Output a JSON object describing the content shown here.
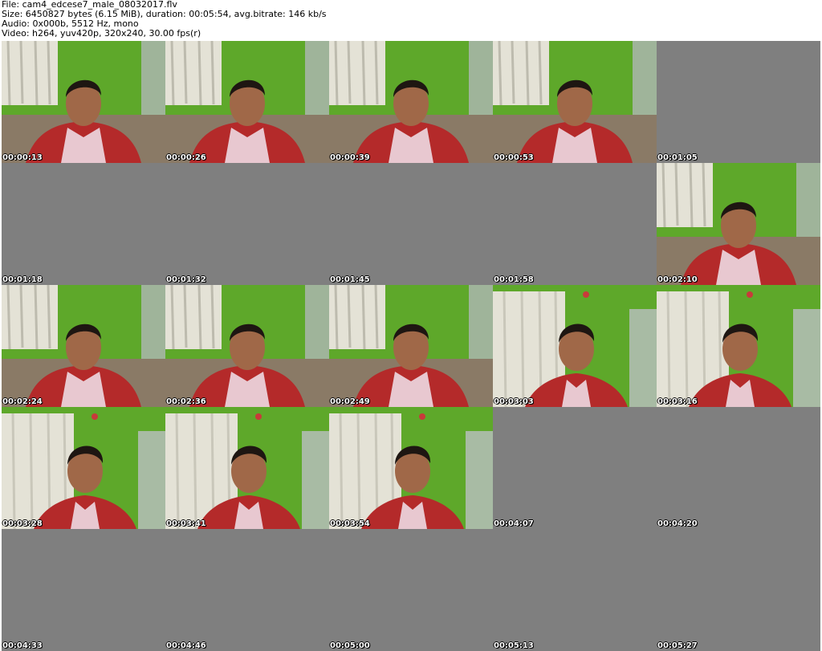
{
  "header": {
    "file_line": "File: cam4_edcese7_male_08032017.flv",
    "size_line": "Size: 6450827 bytes (6.15 MiB), duration: 00:05:54, avg.bitrate: 146 kb/s",
    "audio_line": "Audio: 0x000b, 5512 Hz, mono",
    "video_line": "Video: h264, yuv420p, 320x240, 30.00 fps(r)"
  },
  "colors": {
    "empty_frame": "#7f7f7f",
    "wall_green": "#5ea82a",
    "curtain": "#e4e2d6",
    "shirt": "#e8c8d0",
    "jacket": "#b42a2a",
    "skin": "#a06848",
    "hair": "#1e1612"
  },
  "thumbnails": [
    {
      "time": "00:00:13",
      "frame": "a"
    },
    {
      "time": "00:00:26",
      "frame": "a"
    },
    {
      "time": "00:00:39",
      "frame": "a"
    },
    {
      "time": "00:00:53",
      "frame": "a"
    },
    {
      "time": "00:01:05",
      "frame": "empty"
    },
    {
      "time": "00:01:18",
      "frame": "empty"
    },
    {
      "time": "00:01:32",
      "frame": "empty"
    },
    {
      "time": "00:01:45",
      "frame": "empty"
    },
    {
      "time": "00:01:58",
      "frame": "empty"
    },
    {
      "time": "00:02:10",
      "frame": "a"
    },
    {
      "time": "00:02:24",
      "frame": "a"
    },
    {
      "time": "00:02:36",
      "frame": "a"
    },
    {
      "time": "00:02:49",
      "frame": "a"
    },
    {
      "time": "00:03:03",
      "frame": "b"
    },
    {
      "time": "00:03:16",
      "frame": "b"
    },
    {
      "time": "00:03:28",
      "frame": "b"
    },
    {
      "time": "00:03:41",
      "frame": "b"
    },
    {
      "time": "00:03:54",
      "frame": "b"
    },
    {
      "time": "00:04:07",
      "frame": "empty"
    },
    {
      "time": "00:04:20",
      "frame": "empty"
    },
    {
      "time": "00:04:33",
      "frame": "empty"
    },
    {
      "time": "00:04:46",
      "frame": "empty"
    },
    {
      "time": "00:05:00",
      "frame": "empty"
    },
    {
      "time": "00:05:13",
      "frame": "empty"
    },
    {
      "time": "00:05:27",
      "frame": "empty"
    }
  ]
}
